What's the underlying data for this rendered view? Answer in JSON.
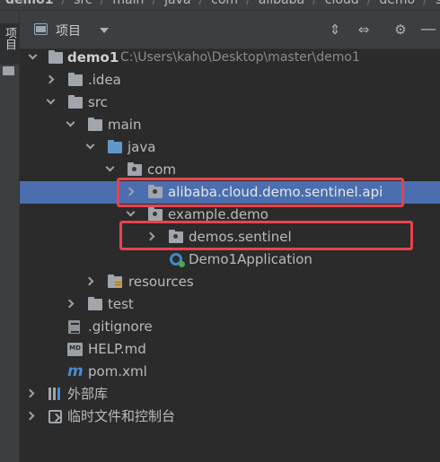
{
  "breadcrumb": [
    "demo1",
    "src",
    "main",
    "java",
    "com",
    "alibaba",
    "cloud",
    "demo",
    "se"
  ],
  "toolwindow_tab": "项目",
  "panel": {
    "title": "项目",
    "icons": [
      "panel-icon",
      "dropdown-icon",
      "scroll-to-source-icon",
      "collapse-all-icon",
      "gear-icon",
      "minimize-icon"
    ]
  },
  "tree": {
    "root": {
      "name": "demo1",
      "path": "C:\\Users\\kaho\\Desktop\\master\\demo1"
    },
    "idea": ".idea",
    "src": "src",
    "main": "main",
    "java": "java",
    "com": "com",
    "pkg_api": "alibaba.cloud.demo.sentinel.api",
    "pkg_example": "example.demo",
    "pkg_demos": "demos.sentinel",
    "app_class": "Demo1Application",
    "resources": "resources",
    "test": "test",
    "gitignore": ".gitignore",
    "help": "HELP.md",
    "pom": "pom.xml",
    "external_libs": "外部库",
    "scratches": "临时文件和控制台"
  },
  "colors": {
    "background": "#2b2b2b",
    "selection": "#4b6eaf",
    "highlight_box": "#e8434f"
  }
}
